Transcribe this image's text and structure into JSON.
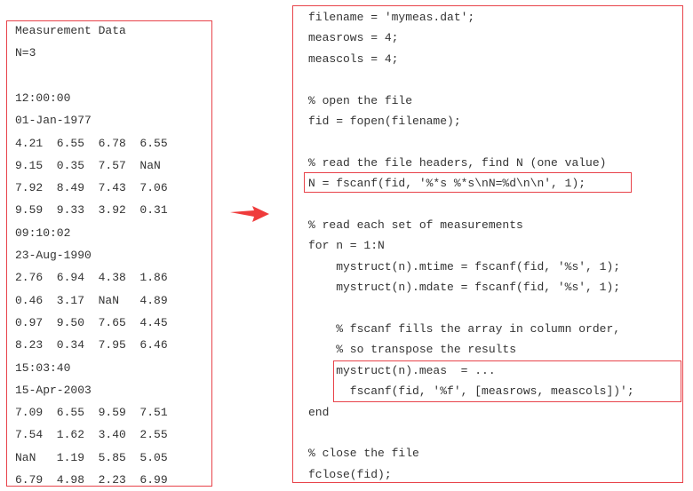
{
  "data_file": {
    "lines": [
      "Measurement Data",
      "N=3",
      "",
      "12:00:00",
      "01-Jan-1977",
      "4.21  6.55  6.78  6.55",
      "9.15  0.35  7.57  NaN",
      "7.92  8.49  7.43  7.06",
      "9.59  9.33  3.92  0.31",
      "09:10:02",
      "23-Aug-1990",
      "2.76  6.94  4.38  1.86",
      "0.46  3.17  NaN   4.89",
      "0.97  9.50  7.65  4.45",
      "8.23  0.34  7.95  6.46",
      "15:03:40",
      "15-Apr-2003",
      "7.09  6.55  9.59  7.51",
      "7.54  1.62  3.40  2.55",
      "NaN   1.19  5.85  5.05",
      "6.79  4.98  2.23  6.99"
    ]
  },
  "code": {
    "lines": [
      "filename = 'mymeas.dat';",
      "measrows = 4;",
      "meascols = 4;",
      "",
      "% open the file",
      "fid = fopen(filename);",
      "",
      "% read the file headers, find N (one value)",
      "N = fscanf(fid, '%*s %*s\\nN=%d\\n\\n', 1);",
      "",
      "% read each set of measurements",
      "for n = 1:N",
      "    mystruct(n).mtime = fscanf(fid, '%s', 1);",
      "    mystruct(n).mdate = fscanf(fid, '%s', 1);",
      "",
      "    % fscanf fills the array in column order,",
      "    % so transpose the results",
      "    mystruct(n).meas  = ...",
      "      fscanf(fid, '%f', [measrows, meascols])';",
      "end",
      "",
      "% close the file",
      "fclose(fid);"
    ]
  },
  "colors": {
    "border": "#e8434a",
    "arrow": "#ef3b3b",
    "text": "#333333"
  }
}
